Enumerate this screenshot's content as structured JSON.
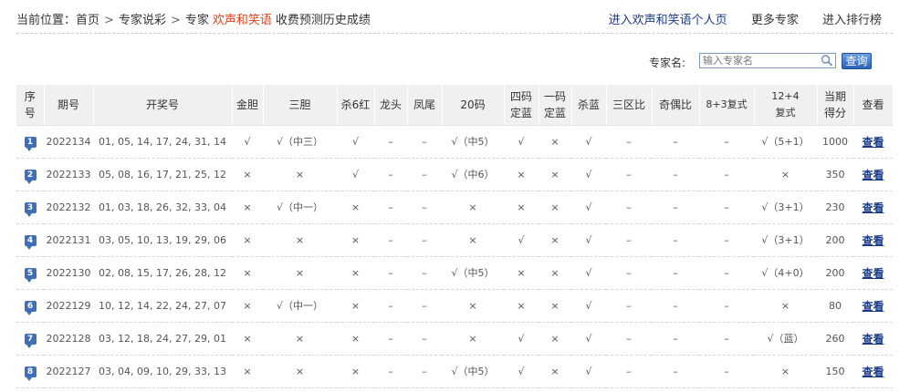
{
  "breadcrumb": {
    "prefix": "当前位置：",
    "home": "首页",
    "sep": ">",
    "section": "专家说彩",
    "expert_prefix": "专家",
    "expert_name": "欢声和笑语",
    "page": "收费预测历史成绩"
  },
  "toplinks": {
    "personal_page": "进入欢声和笑语个人页",
    "more_experts": "更多专家",
    "ranking": "进入排行榜"
  },
  "search": {
    "label": "专家名:",
    "placeholder": "输入专家名",
    "button": "查询"
  },
  "colors": {
    "hit": "#d63c1e",
    "link": "#1a3b8a",
    "rank_badge": "#3f6fb7"
  },
  "columns": [
    "序号",
    "期号",
    "开奖号",
    "金胆",
    "三胆",
    "杀6红",
    "龙头",
    "凤尾",
    "20码",
    "四码定蓝",
    "一码定蓝",
    "杀蓝",
    "三区比",
    "奇偶比",
    "8+3复式",
    "12+4复式",
    "当期得分",
    "查看"
  ],
  "rows": [
    {
      "rank": "1",
      "issue": "2022134",
      "numbers": "01, 05, 14, 17, 24, 31, 14",
      "cells": [
        "√",
        "√（中三）",
        "√",
        "–",
        "–",
        "√（中5）",
        "√",
        "×",
        "√",
        "–",
        "–",
        "–",
        "√（5+1）"
      ],
      "score": "1000",
      "view": "查看"
    },
    {
      "rank": "2",
      "issue": "2022133",
      "numbers": "05, 08, 16, 17, 21, 25, 12",
      "cells": [
        "×",
        "×",
        "√",
        "–",
        "–",
        "√（中6）",
        "×",
        "×",
        "√",
        "–",
        "–",
        "–",
        "×"
      ],
      "score": "350",
      "view": "查看"
    },
    {
      "rank": "3",
      "issue": "2022132",
      "numbers": "01, 03, 18, 26, 32, 33, 04",
      "cells": [
        "×",
        "√（中一）",
        "×",
        "–",
        "–",
        "×",
        "×",
        "×",
        "√",
        "–",
        "–",
        "–",
        "√（3+1）"
      ],
      "score": "230",
      "view": "查看"
    },
    {
      "rank": "4",
      "issue": "2022131",
      "numbers": "03, 05, 10, 13, 19, 29, 06",
      "cells": [
        "×",
        "×",
        "×",
        "–",
        "–",
        "×",
        "√",
        "×",
        "√",
        "–",
        "–",
        "–",
        "√（3+1）"
      ],
      "score": "200",
      "view": "查看"
    },
    {
      "rank": "5",
      "issue": "2022130",
      "numbers": "02, 08, 15, 17, 26, 28, 12",
      "cells": [
        "×",
        "×",
        "×",
        "–",
        "–",
        "√（中5）",
        "×",
        "×",
        "√",
        "–",
        "–",
        "–",
        "√（4+0）"
      ],
      "score": "200",
      "view": "查看"
    },
    {
      "rank": "6",
      "issue": "2022129",
      "numbers": "10, 12, 14, 22, 24, 27, 07",
      "cells": [
        "×",
        "√（中一）",
        "×",
        "–",
        "–",
        "×",
        "×",
        "×",
        "√",
        "–",
        "–",
        "–",
        "×"
      ],
      "score": "80",
      "view": "查看"
    },
    {
      "rank": "7",
      "issue": "2022128",
      "numbers": "03, 12, 18, 24, 27, 29, 01",
      "cells": [
        "×",
        "×",
        "×",
        "–",
        "–",
        "×",
        "√",
        "×",
        "√",
        "–",
        "–",
        "–",
        "√（蓝）"
      ],
      "score": "260",
      "view": "查看"
    },
    {
      "rank": "8",
      "issue": "2022127",
      "numbers": "03, 04, 09, 10, 29, 33, 13",
      "cells": [
        "×",
        "×",
        "×",
        "–",
        "–",
        "√（中5）",
        "√",
        "×",
        "√",
        "–",
        "–",
        "–",
        "×"
      ],
      "score": "150",
      "view": "查看"
    }
  ]
}
